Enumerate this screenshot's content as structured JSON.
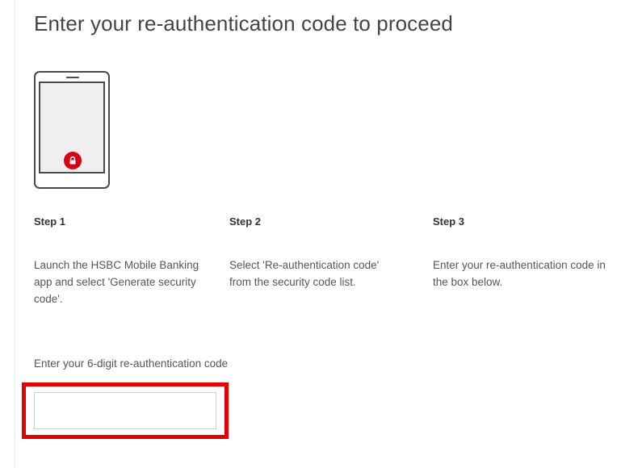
{
  "page": {
    "title": "Enter your re-authentication code to proceed"
  },
  "illustration": {
    "device": "phone-icon",
    "badge": "lock-icon",
    "badge_color": "#db0011"
  },
  "steps": [
    {
      "title": "Step 1",
      "text": "Launch the HSBC Mobile Banking app and select 'Generate security code'."
    },
    {
      "title": "Step 2",
      "text": "Select 'Re-authentication code' from the security code list."
    },
    {
      "title": "Step 3",
      "text": "Enter your re-authentication code in the box below."
    }
  ],
  "code_field": {
    "label": "Enter your 6-digit re-authentication code",
    "value": "",
    "highlight_color": "#e30000"
  }
}
